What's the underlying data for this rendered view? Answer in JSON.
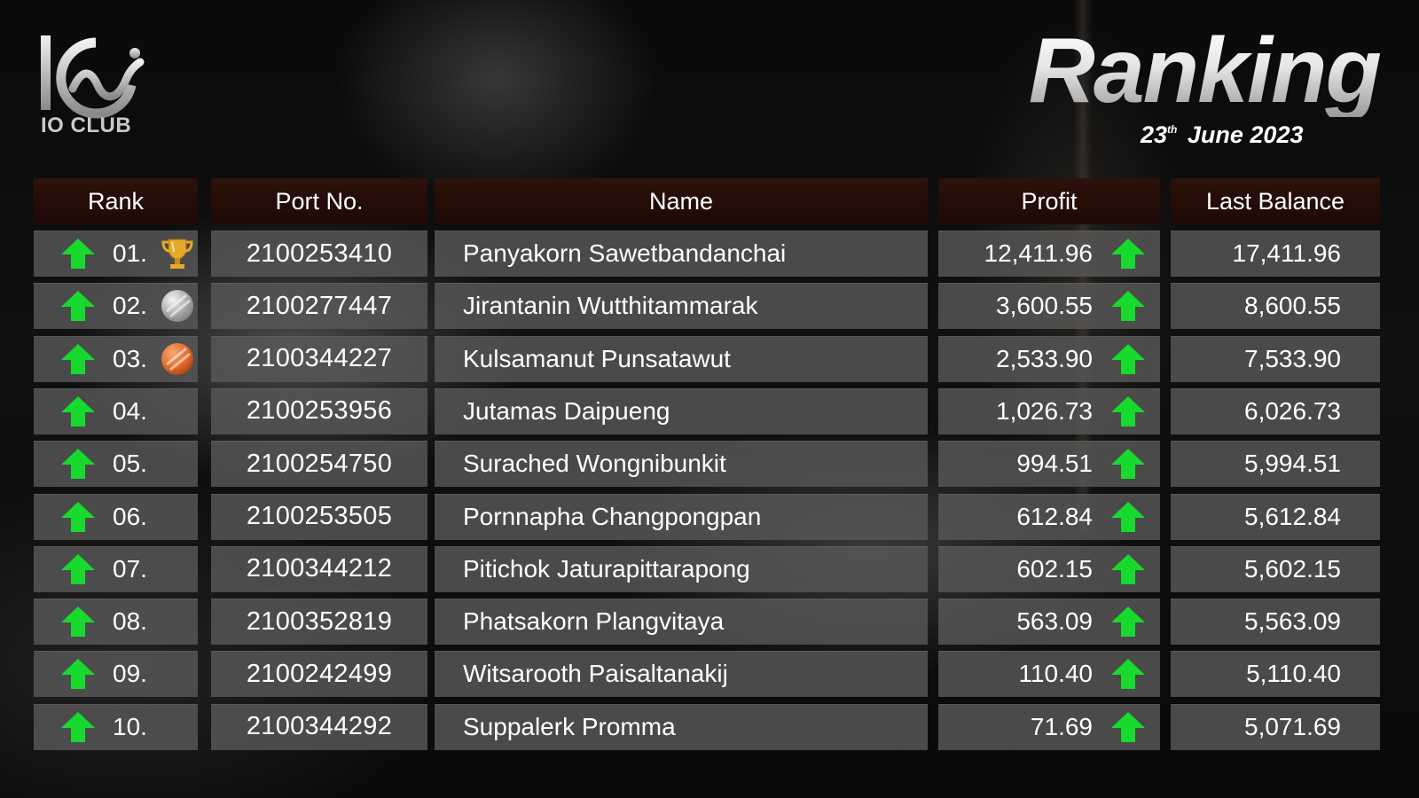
{
  "brand": {
    "name": "IO CLUB"
  },
  "header": {
    "title": "Ranking",
    "date_day": "23",
    "date_suffix": "th",
    "date_rest": "June 2023"
  },
  "columns": {
    "rank": "Rank",
    "port": "Port No.",
    "name": "Name",
    "profit": "Profit",
    "balance": "Last Balance"
  },
  "colors": {
    "arrow_up": "#18d92e",
    "header_bg": "#2a1009",
    "row_bg": "#585858",
    "gold": "#e6a92b",
    "silver": "#cfcfcf",
    "bronze": "#e06a2a"
  },
  "rows": [
    {
      "rank": "01.",
      "medal": "trophy-icon",
      "port": "2100253410",
      "name": "Panyakorn Sawetbandanchai",
      "profit": "12,411.96",
      "balance": "17,411.96"
    },
    {
      "rank": "02.",
      "medal": "silver-medal-icon",
      "port": "2100277447",
      "name": "Jirantanin Wutthitammarak",
      "profit": "3,600.55",
      "balance": "8,600.55"
    },
    {
      "rank": "03.",
      "medal": "bronze-medal-icon",
      "port": "2100344227",
      "name": "Kulsamanut Punsatawut",
      "profit": "2,533.90",
      "balance": "7,533.90"
    },
    {
      "rank": "04.",
      "medal": "",
      "port": "2100253956",
      "name": "Jutamas Daipueng",
      "profit": "1,026.73",
      "balance": "6,026.73"
    },
    {
      "rank": "05.",
      "medal": "",
      "port": "2100254750",
      "name": "Surached Wongnibunkit",
      "profit": "994.51",
      "balance": "5,994.51"
    },
    {
      "rank": "06.",
      "medal": "",
      "port": "2100253505",
      "name": "Pornnapha Changpongpan",
      "profit": "612.84",
      "balance": "5,612.84"
    },
    {
      "rank": "07.",
      "medal": "",
      "port": "2100344212",
      "name": "Pitichok Jaturapittarapong",
      "profit": "602.15",
      "balance": "5,602.15"
    },
    {
      "rank": "08.",
      "medal": "",
      "port": "2100352819",
      "name": "Phatsakorn Plangvitaya",
      "profit": "563.09",
      "balance": "5,563.09"
    },
    {
      "rank": "09.",
      "medal": "",
      "port": "2100242499",
      "name": "Witsarooth Paisaltanakij",
      "profit": "110.40",
      "balance": "5,110.40"
    },
    {
      "rank": "10.",
      "medal": "",
      "port": "2100344292",
      "name": "Suppalerk Promma",
      "profit": "71.69",
      "balance": "5,071.69"
    }
  ]
}
